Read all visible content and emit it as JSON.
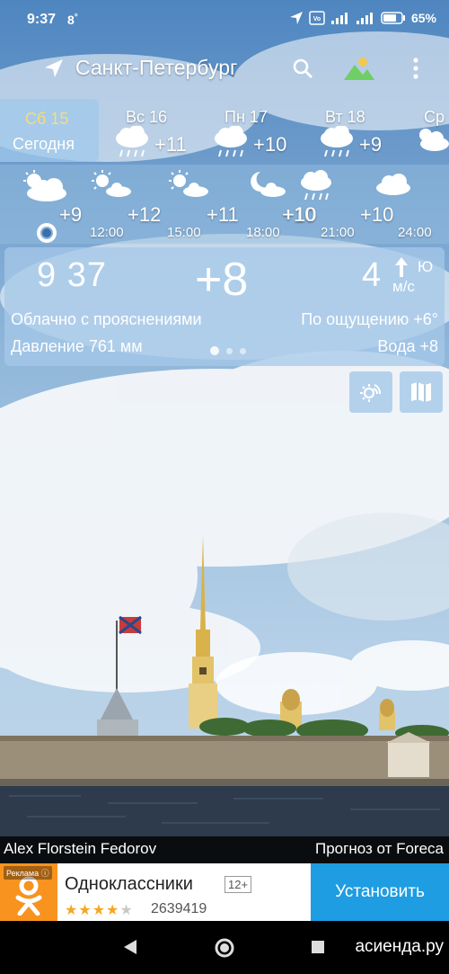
{
  "status_bar": {
    "time": "9:37",
    "extra": "8",
    "battery": "65%"
  },
  "header": {
    "city": "Санкт-Петербург"
  },
  "days": [
    {
      "name": "Сб 15",
      "sub": "Сегодня",
      "temp": "",
      "selected": true
    },
    {
      "name": "Вс 16",
      "temp": "+11",
      "icon": "cloud-rain-icon"
    },
    {
      "name": "Пн 17",
      "temp": "+10",
      "icon": "cloud-rain-icon"
    },
    {
      "name": "Вт 18",
      "temp": "+9",
      "icon": "cloud-rain-icon"
    },
    {
      "name": "Ср",
      "temp": "",
      "icon": "partly-cloudy-icon"
    }
  ],
  "hourly": [
    {
      "time": "",
      "temp": "+9",
      "icon": "partly-cloudy-icon"
    },
    {
      "time": "12:00",
      "temp": "+12",
      "icon": "sun-cloud-icon"
    },
    {
      "time": "15:00",
      "temp": "+11",
      "icon": "sun-cloud-icon"
    },
    {
      "time": "18:00",
      "temp": "+10",
      "icon": "moon-cloud-icon"
    },
    {
      "time": "21:00",
      "temp": "+10",
      "icon": "cloud-rain-icon"
    },
    {
      "time": "24:00",
      "temp": "+10",
      "icon": "cloud-icon"
    }
  ],
  "current": {
    "time": "9 37",
    "temp": "+8",
    "wind_speed": "4",
    "wind_unit": "м/с",
    "wind_dir": "Ю",
    "condition": "Облачно с прояснениями",
    "feels_like": "По ощущению +6°",
    "pressure": "Давление 761 мм",
    "water": "Вода +8"
  },
  "credits": {
    "author": "Alex Florstein Fedorov",
    "source": "Прогноз от Foreca"
  },
  "ad": {
    "badge": "Реклама",
    "title": "Одноклассники",
    "age": "12+",
    "rating_count": "2639419",
    "rating_stars": 4,
    "install": "Установить"
  },
  "watermark": "асиенда.ру",
  "colors": {
    "ad_button": "#1e9de2",
    "ad_logo": "#f7931e",
    "today_label": "#f6dd7a"
  }
}
